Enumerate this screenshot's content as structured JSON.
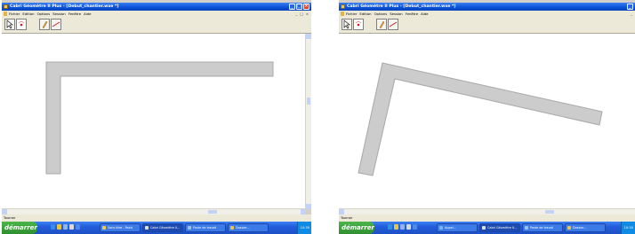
{
  "window": {
    "title": "Cabri Géomètre II Plus - [Debut_chantier.wxe *]",
    "minimize": "_",
    "maximize": "□",
    "close": "×"
  },
  "menubar": {
    "items": [
      "Fichier",
      "Edition",
      "Options",
      "Session",
      "Fenêtre",
      "Aide"
    ],
    "mdi_controls": [
      "_",
      "□",
      "×"
    ]
  },
  "toolbar": {
    "tools": [
      {
        "name": "pointer",
        "icon": "pointer-arrow-icon"
      },
      {
        "name": "point",
        "icon": "point-icon"
      },
      {
        "name": "pencil",
        "icon": "pencil-icon"
      },
      {
        "name": "line",
        "icon": "line-icon"
      }
    ]
  },
  "status": {
    "text": "Tourner"
  },
  "shape_color": "#cccccc",
  "taskbar": {
    "start_label": "démarrer",
    "left_tasks": [
      "Sans titre - Paint",
      "Cabri Géomètre II...",
      "Poste de travail",
      "Dossier..."
    ],
    "right_tasks": [
      "Appel...",
      "Cabri Géomètre II...",
      "Poste de travail",
      "Dossier..."
    ],
    "clock": "10:30"
  }
}
